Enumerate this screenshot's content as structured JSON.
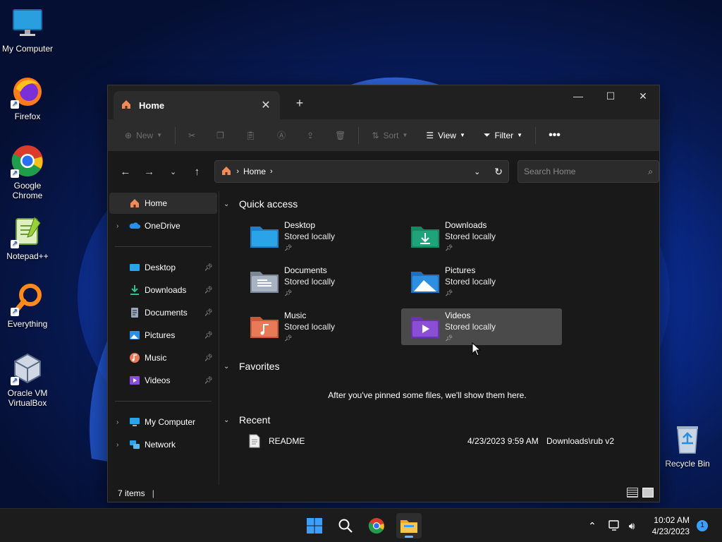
{
  "desktop": {
    "icons": [
      {
        "label": "My Computer"
      },
      {
        "label": "Firefox"
      },
      {
        "label": "Google Chrome"
      },
      {
        "label": "Notepad++"
      },
      {
        "label": "Everything"
      },
      {
        "label": "Oracle VM VirtualBox"
      },
      {
        "label": "Recycle Bin"
      }
    ]
  },
  "window": {
    "tab_title": "Home",
    "toolbar": {
      "new_label": "New",
      "sort_label": "Sort",
      "view_label": "View",
      "filter_label": "Filter"
    },
    "address": {
      "crumb": "Home"
    },
    "search": {
      "placeholder": "Search Home"
    },
    "nav": {
      "items": [
        {
          "label": "Home"
        },
        {
          "label": "OneDrive"
        },
        {
          "label": "Desktop"
        },
        {
          "label": "Downloads"
        },
        {
          "label": "Documents"
        },
        {
          "label": "Pictures"
        },
        {
          "label": "Music"
        },
        {
          "label": "Videos"
        },
        {
          "label": "My Computer"
        },
        {
          "label": "Network"
        }
      ]
    },
    "sections": {
      "quick_access": "Quick access",
      "favorites": "Favorites",
      "recent": "Recent"
    },
    "quick_access": [
      {
        "name": "Desktop",
        "sub": "Stored locally",
        "color": "#2aa3e8"
      },
      {
        "name": "Downloads",
        "sub": "Stored locally",
        "color": "#1fa37a"
      },
      {
        "name": "Documents",
        "sub": "Stored locally",
        "color": "#9aa7b8"
      },
      {
        "name": "Pictures",
        "sub": "Stored locally",
        "color": "#2e8fe0"
      },
      {
        "name": "Music",
        "sub": "Stored locally",
        "color": "#e87a5a"
      },
      {
        "name": "Videos",
        "sub": "Stored locally",
        "color": "#8b4fd6"
      }
    ],
    "favorites_empty": "After you've pinned some files, we'll show them here.",
    "recent": [
      {
        "name": "README",
        "date": "4/23/2023 9:59 AM",
        "location": "Downloads\\rub v2"
      }
    ],
    "status": {
      "count": "7 items",
      "cursor": "|"
    }
  },
  "taskbar": {
    "time": "10:02 AM",
    "date": "4/23/2023",
    "notifications": "1"
  }
}
